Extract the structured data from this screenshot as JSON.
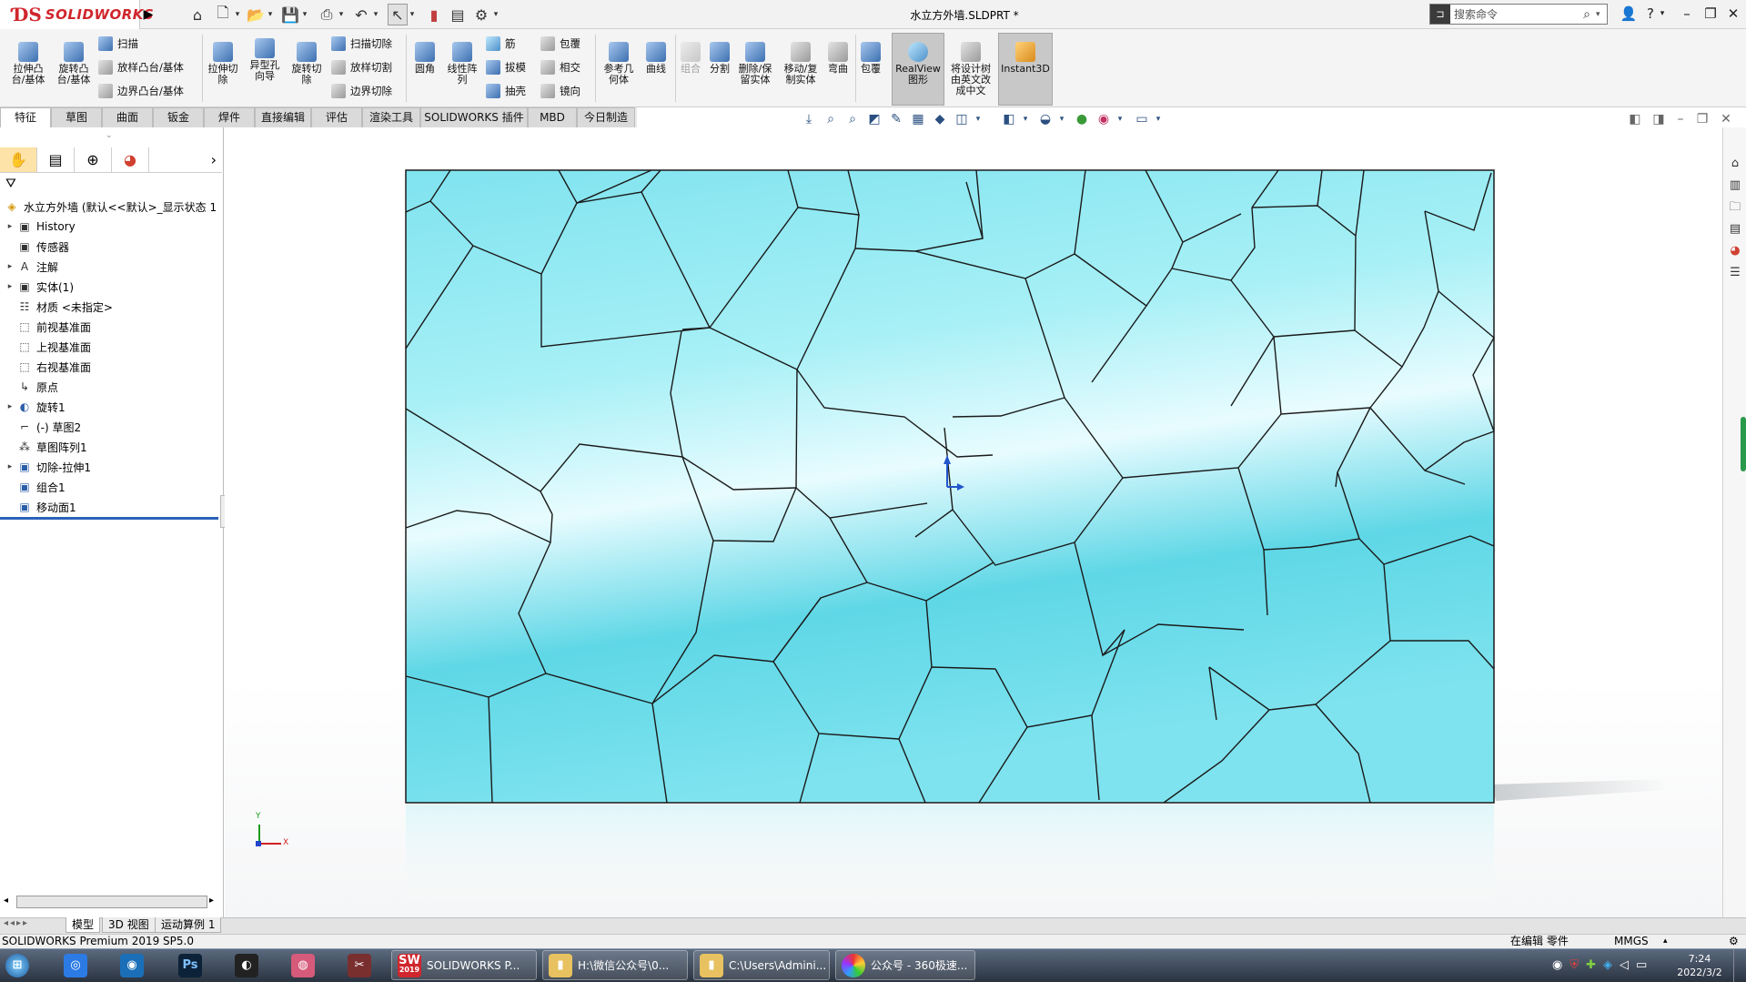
{
  "app": {
    "brand": "SOLIDWORKS",
    "document_title": "水立方外墙.SLDPRT *"
  },
  "search": {
    "placeholder": "搜索命令"
  },
  "ribbon": {
    "features": {
      "extrude_boss": "拉伸凸\n台/基体",
      "revolve_boss": "旋转凸\n台/基体",
      "sweep": "扫描",
      "loft_boss": "放样凸台/基体",
      "boundary_boss": "边界凸台/基体",
      "extrude_cut": "拉伸切\n除",
      "hole_wizard": "异型孔\n向导",
      "revolve_cut": "旋转切\n除",
      "swept_cut": "扫描切除",
      "lofted_cut": "放样切割",
      "boundary_cut": "边界切除",
      "fillet": "圆角",
      "linear_pattern": "线性阵\n列",
      "rib": "筋",
      "draft": "拔模",
      "shell": "抽壳",
      "wrap": "包覆",
      "intersect": "相交",
      "mirror": "镜向",
      "reference_geometry": "参考几\n何体",
      "curves": "曲线",
      "combine": "组合",
      "split": "分割",
      "delete_keep_body": "删除/保\n留实体",
      "move_copy_body": "移动/复\n制实体",
      "flex": "弯曲",
      "wrap2": "包覆",
      "realview": "RealView\n图形",
      "translate_tree": "将设计树\n由英文改\n成中文",
      "instant3d": "Instant3D"
    }
  },
  "tabs": [
    "特征",
    "草图",
    "曲面",
    "钣金",
    "焊件",
    "直接编辑",
    "评估",
    "渲染工具",
    "SOLIDWORKS 插件",
    "MBD",
    "今日制造"
  ],
  "tree": {
    "root": "水立方外墙 (默认<<默认>_显示状态 1",
    "items": [
      "History",
      "传感器",
      "注解",
      "实体(1)",
      "材质 <未指定>",
      "前视基准面",
      "上视基准面",
      "右视基准面",
      "原点",
      "旋转1",
      "(-) 草图2",
      "草图阵列1",
      "切除-拉伸1",
      "组合1",
      "移动面1"
    ]
  },
  "bottom_tabs": [
    "模型",
    "3D 视图",
    "运动算例 1"
  ],
  "status": {
    "product": "SOLIDWORKS Premium 2019 SP5.0",
    "mode": "在编辑 零件",
    "units": "MMGS"
  },
  "taskbar": {
    "items": [
      "SOLIDWORKS P...",
      "H:\\微信公众号\\0...",
      "C:\\Users\\Admini...",
      "公众号 - 360极速..."
    ],
    "sw_badge": "2019",
    "time": "7:24",
    "date": "2022/3/2"
  },
  "triad": {
    "y": "Y",
    "x": "X"
  },
  "colors": {
    "brand_red": "#d0262d",
    "glass_cyan": "#7fe3ef",
    "panel_line": "#1a1a1a",
    "selected_tab": "#ffffff"
  }
}
